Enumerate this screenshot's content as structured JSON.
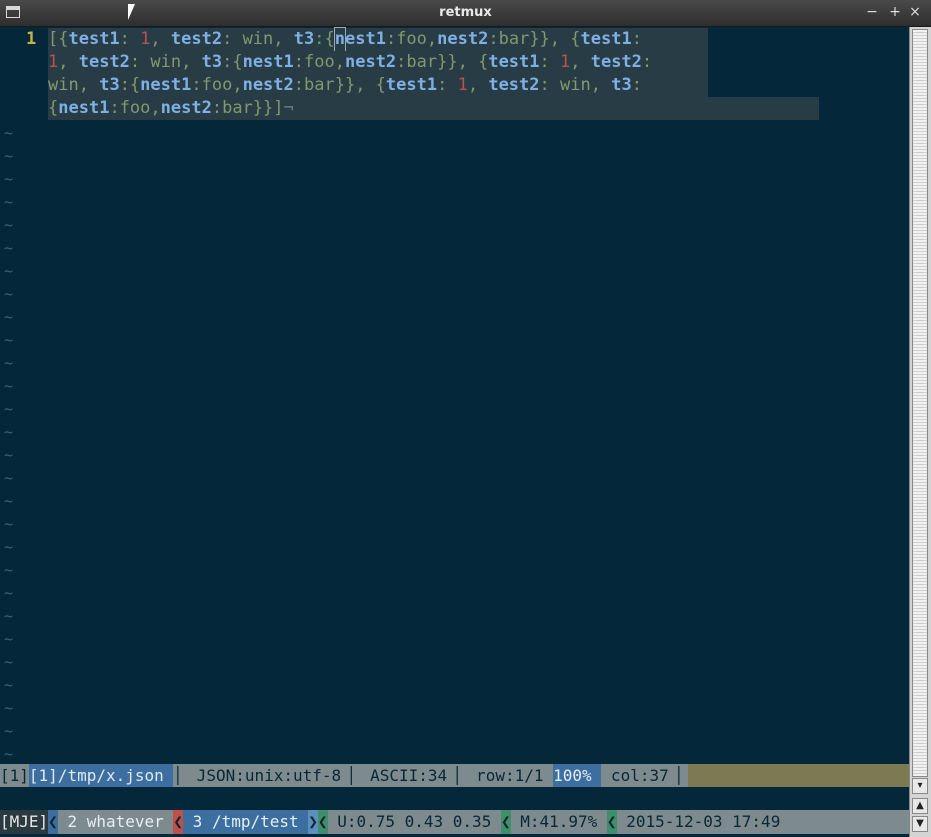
{
  "window": {
    "title": "retmux",
    "minimize": "−",
    "maximize": "+",
    "close": "×"
  },
  "editor": {
    "line_number": "1",
    "tilde": "~",
    "newline_marker": "¬",
    "lines": [
      "[{test1: 1, test2: win, t3:{nest1:foo,nest2:bar}}, {test1:",
      "1, test2: win, t3:{nest1:foo,nest2:bar}}, {test1: 1, test2:",
      "win, t3:{nest1:foo,nest2:bar}}, {test1: 1, test2: win, t3:",
      "{nest1:foo,nest2:bar}}]"
    ]
  },
  "statusline": {
    "buffer": "[1]/tmp/x.json ",
    "filetype": " JSON:unix:utf-8 ",
    "ascii": " ASCII:34 ",
    "row": " row:1/1 ",
    "percent": "100% ",
    "col": " col:37 ",
    "sep": "▏"
  },
  "tmux": {
    "session": "[MJE]",
    "win2": " 2 whatever ",
    "win3": " 3 /tmp/test ",
    "load": " U:0.75 0.43 0.35 ",
    "mem": " M:41.97% ",
    "datetime": " 2015-12-03 17:49",
    "sep_left": "❮",
    "sep_right": "❯"
  },
  "colors": {
    "background": "#04283a",
    "keyword": "#7fb0e4",
    "number": "#c0504a",
    "string": "#7f9a6e",
    "line_number": "#c8b24a",
    "active_window": "#3d6ea0"
  }
}
